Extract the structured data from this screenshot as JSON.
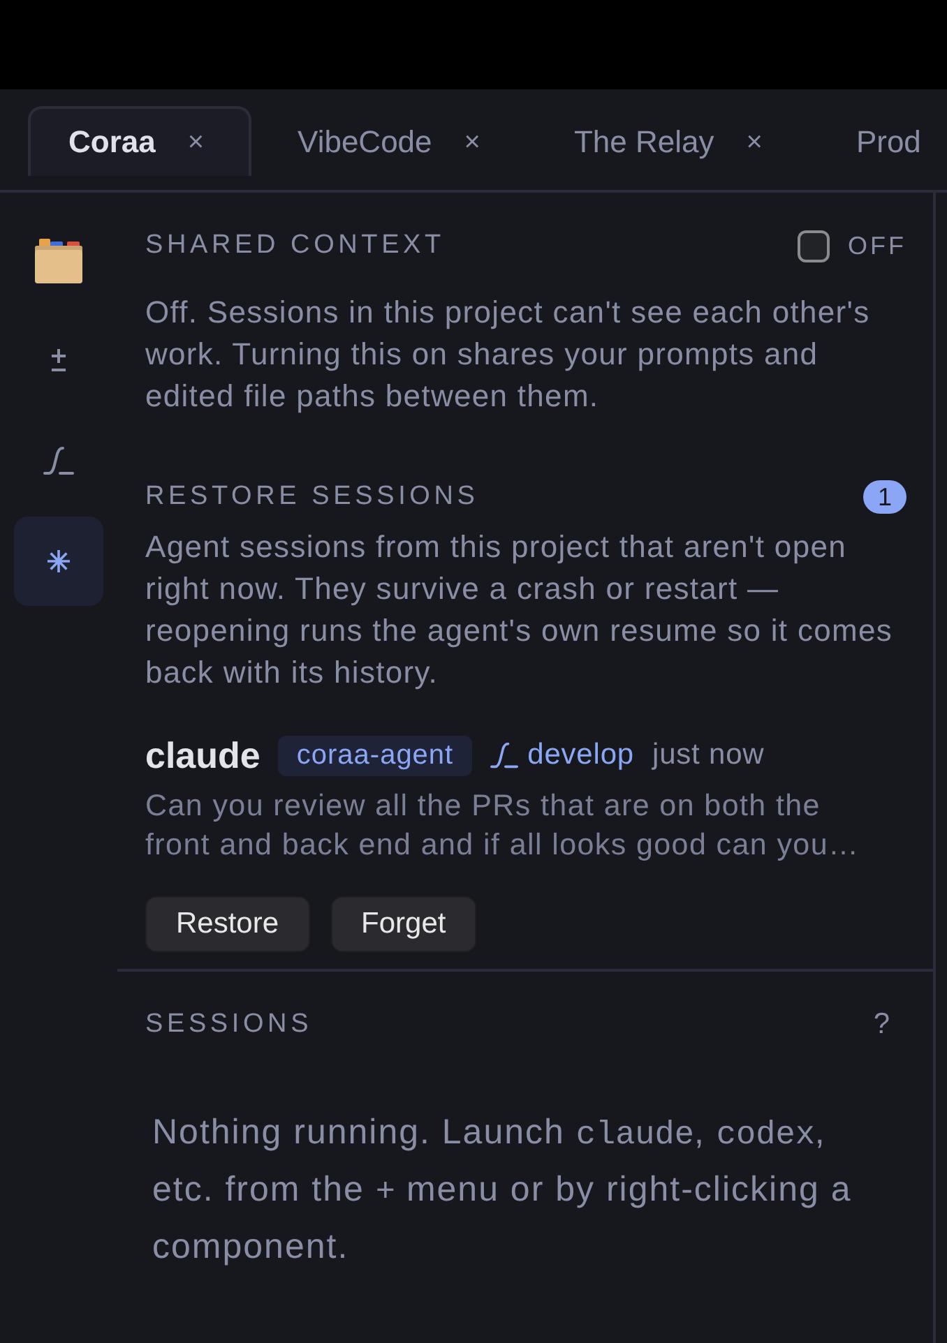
{
  "tabs": [
    {
      "label": "Coraa",
      "close": "×",
      "selected": true
    },
    {
      "label": "VibeCode",
      "close": "×",
      "selected": false
    },
    {
      "label": "The Relay",
      "close": "×",
      "selected": false
    },
    {
      "label": "Prod",
      "selected": false
    }
  ],
  "rail": {
    "items": [
      {
        "kind": "file-box",
        "selected": false
      },
      {
        "kind": "plus-minus",
        "selected": false
      },
      {
        "kind": "curve",
        "selected": false
      },
      {
        "kind": "asterisk",
        "selected": true
      }
    ]
  },
  "shared_context": {
    "title": "SHARED CONTEXT",
    "toggle": {
      "checked": false,
      "label": "OFF"
    },
    "description": "Off. Sessions in this project can't see each other's work. Turning this on shares your prompts and edited file paths between them."
  },
  "restore_sessions": {
    "title": "RESTORE SESSIONS",
    "count": "1",
    "description": "Agent sessions from this project that aren't open right now. They survive a crash or restart — reopening runs the agent's own resume so it comes back with its history.",
    "sessions": [
      {
        "agent": "claude",
        "project": "coraa-agent",
        "branch": "develop",
        "time": "just now",
        "preview": "Can you review all the PRs that are on both the front and back end and if all looks good can you…",
        "actions": [
          "Restore",
          "Forget"
        ]
      }
    ]
  },
  "sessions": {
    "title": "SESSIONS",
    "help": "?",
    "empty_message": [
      {
        "kind": "text",
        "text": "Nothing running. Launch "
      },
      {
        "kind": "code",
        "text": "claude"
      },
      {
        "kind": "text",
        "text": ", "
      },
      {
        "kind": "code",
        "text": "codex"
      },
      {
        "kind": "text",
        "text": ", etc. from the "
      },
      {
        "kind": "code",
        "text": "+"
      },
      {
        "kind": "text",
        "text": " menu or by right-clicking a component."
      }
    ]
  }
}
